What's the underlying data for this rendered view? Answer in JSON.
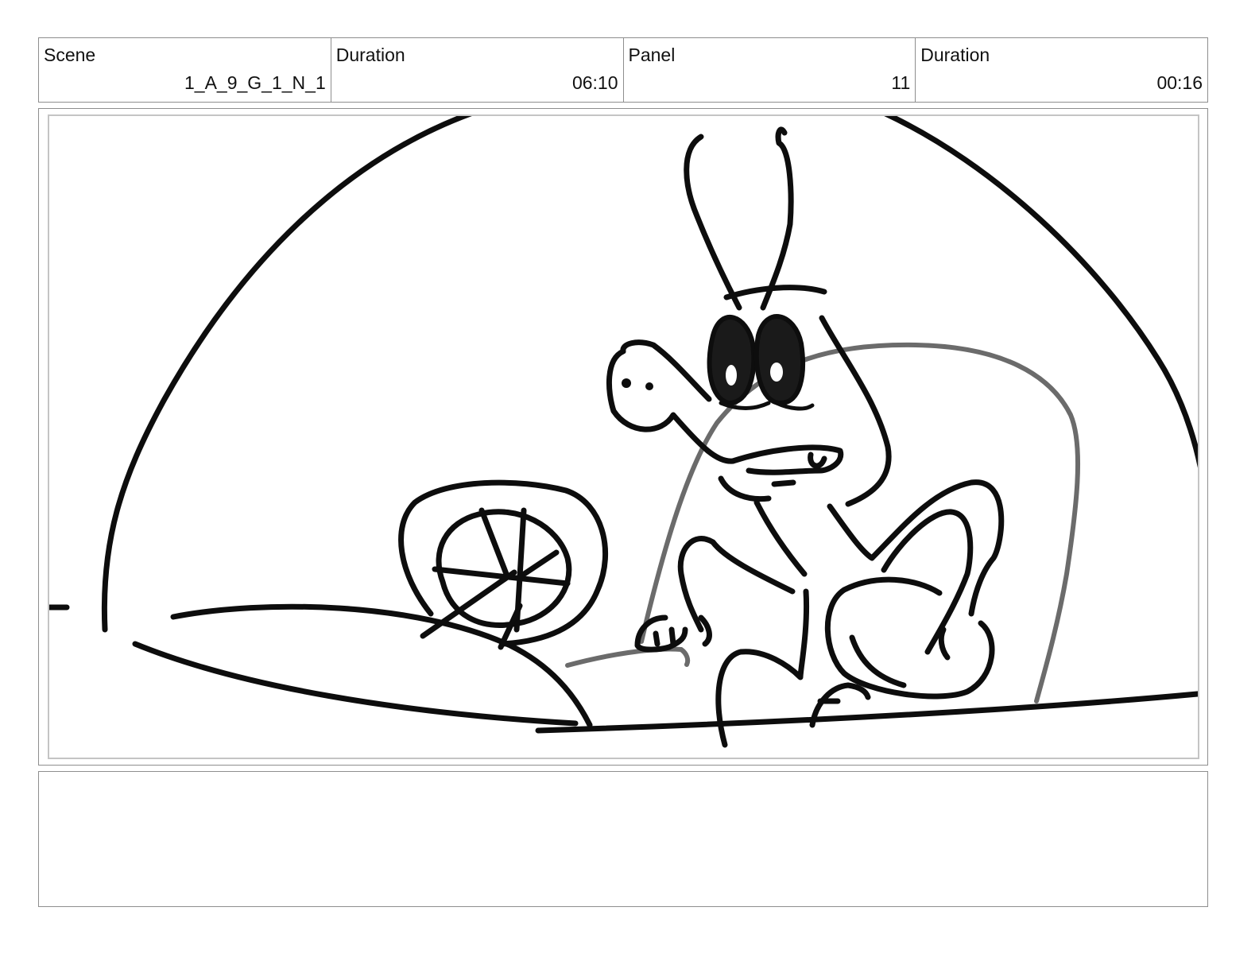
{
  "header": {
    "scene_label": "Scene",
    "scene_value": "1_A_9_G_1_N_1",
    "scene_duration_label": "Duration",
    "scene_duration_value": "06:10",
    "panel_label": "Panel",
    "panel_value": "11",
    "panel_duration_label": "Duration",
    "panel_duration_value": "00:16"
  },
  "panel": {
    "description": ""
  },
  "notes": {
    "text": ""
  }
}
